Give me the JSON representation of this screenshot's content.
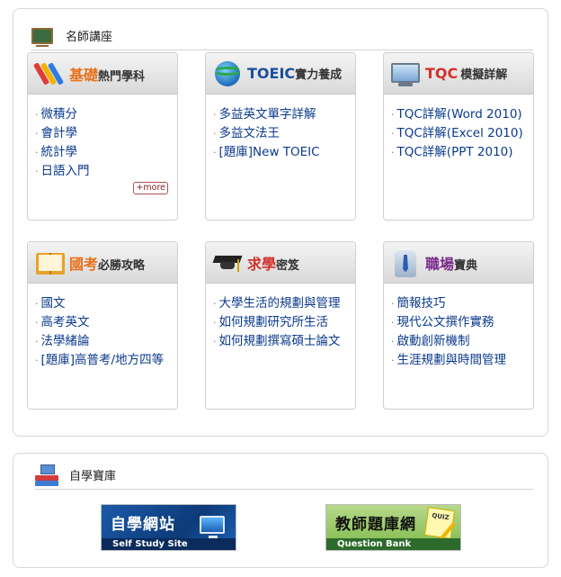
{
  "teachers_panel": {
    "title": "名師講座",
    "cards": [
      {
        "title_accent": "基礎",
        "title_rest": "熱門學科",
        "accent_color": "#e8711a",
        "icon": "pencils-icon",
        "links": [
          "微積分",
          "會計學",
          "統計學",
          "日語入門"
        ],
        "more_label": "+more"
      },
      {
        "title_accent": "TOEIC",
        "title_rest": "實力養成",
        "accent_color": "#1a4f9c",
        "icon": "globe-headset-icon",
        "links": [
          "多益英文單字詳解",
          "多益文法王",
          "[題庫]New TOEIC"
        ]
      },
      {
        "title_accent": "TQC",
        "title_rest": "模擬詳解",
        "accent_color": "#d0312d",
        "icon": "monitor-icon",
        "links": [
          "TQC詳解(Word 2010)",
          "TQC詳解(Excel 2010)",
          "TQC詳解(PPT 2010)"
        ]
      },
      {
        "title_accent": "國考",
        "title_rest": "必勝攻略",
        "accent_color": "#e8711a",
        "icon": "book-icon",
        "links": [
          "國文",
          "高考英文",
          "法學緒論",
          "[題庫]高普考/地方四等"
        ]
      },
      {
        "title_accent": "求學",
        "title_rest": "密笈",
        "accent_color": "#d0312d",
        "icon": "graduation-cap-icon",
        "links": [
          "大學生活的規劃與管理",
          "如何規劃研究所生活",
          "如何規劃撰寫碩士論文"
        ]
      },
      {
        "title_accent": "職場",
        "title_rest": "寶典",
        "accent_color": "#7a2a8a",
        "icon": "business-tie-icon",
        "links": [
          "簡報技巧",
          "現代公文撰作實務",
          "啟動創新機制",
          "生涯規劃與時間管理"
        ]
      }
    ]
  },
  "selfstudy_panel": {
    "title": "自學寶庫",
    "banners": [
      {
        "title": "自學網站",
        "subtitle": "Self Study Site"
      },
      {
        "title": "教師題庫網",
        "subtitle": "Question Bank",
        "note_label": "QUIZ"
      }
    ]
  }
}
